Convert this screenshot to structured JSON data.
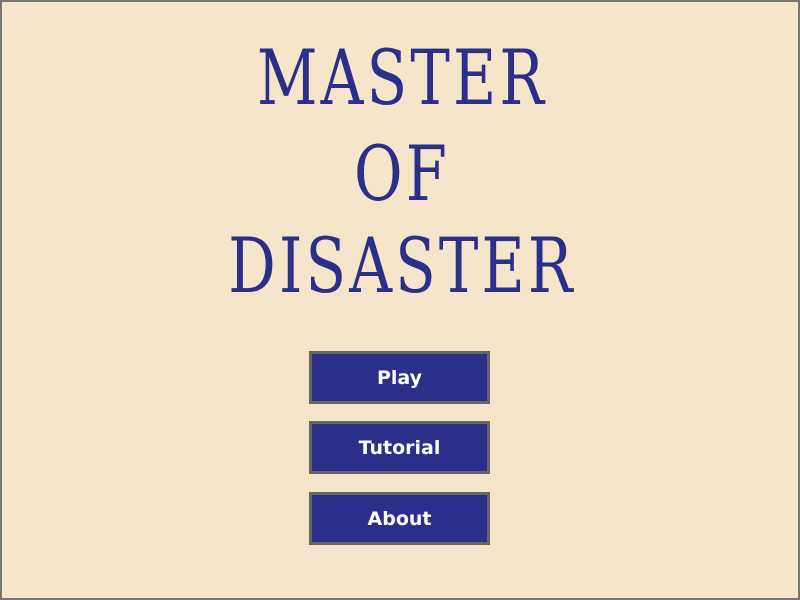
{
  "title": {
    "line1": "MASTER",
    "line2": "OF",
    "line3": "DISASTER"
  },
  "menu": {
    "play_label": "Play",
    "tutorial_label": "Tutorial",
    "about_label": "About"
  },
  "colors": {
    "background": "#f5e5cb",
    "title": "#2c2f8a",
    "button_fill": "#2c2f8a",
    "button_border": "#666666",
    "button_text": "#ffffff",
    "frame_border": "#777777"
  }
}
